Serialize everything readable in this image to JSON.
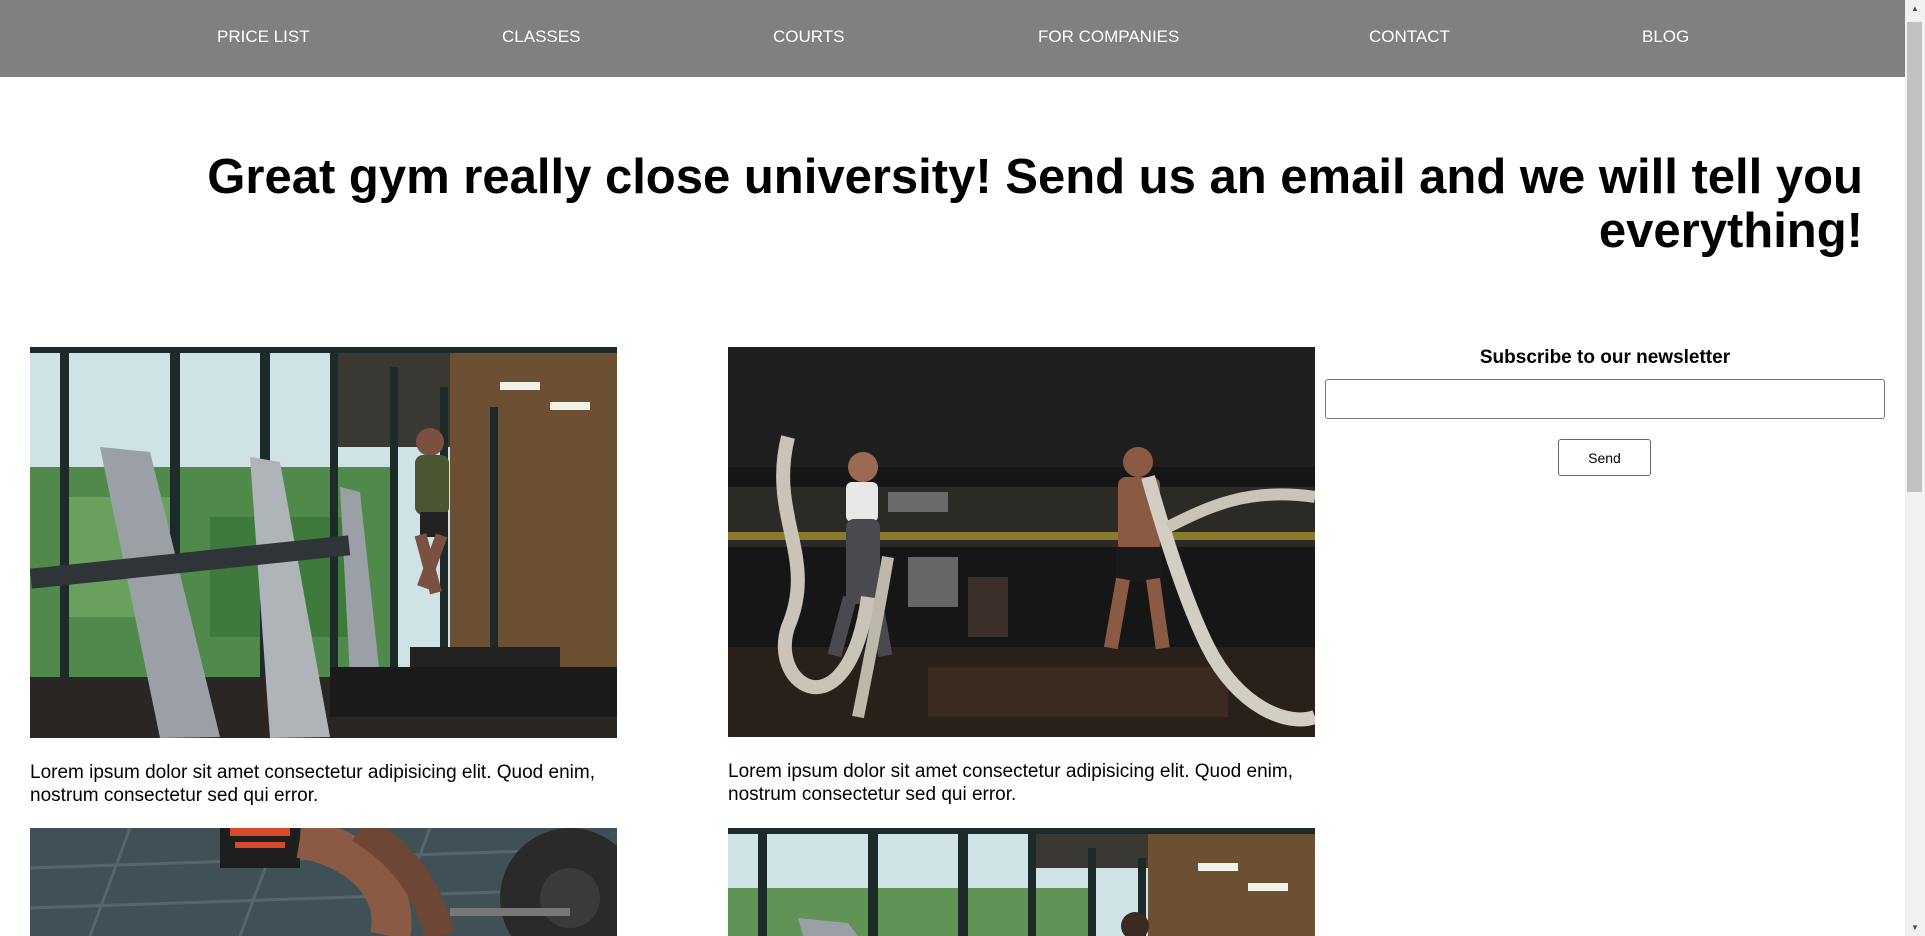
{
  "nav": {
    "items": [
      {
        "label": "PRICE LIST"
      },
      {
        "label": "CLASSES"
      },
      {
        "label": "COURTS"
      },
      {
        "label": "FOR COMPANIES"
      },
      {
        "label": "CONTACT"
      },
      {
        "label": "BLOG"
      }
    ]
  },
  "hero": {
    "title": "Great gym really close university! Send us an email and we will tell you everything!"
  },
  "cards": [
    {
      "image": "treadmill-gym-photo",
      "text": "Lorem ipsum dolor sit amet consectetur adipisicing elit. Quod enim, nostrum consectetur sed qui error."
    },
    {
      "image": "battle-ropes-photo",
      "text": "Lorem ipsum dolor sit amet consectetur adipisicing elit. Quod enim, nostrum consectetur sed qui error."
    },
    {
      "image": "barbell-deadlift-photo"
    },
    {
      "image": "treadmill-gym-photo"
    }
  ],
  "newsletter": {
    "title": "Subscribe to our newsletter",
    "input_value": "",
    "send_label": "Send"
  },
  "colors": {
    "nav_background": "#808080",
    "nav_text": "#ffffff",
    "page_background": "#ffffff"
  },
  "scrollbar": {
    "up_icon": "triangle-up-icon",
    "down_icon": "triangle-down-icon"
  }
}
